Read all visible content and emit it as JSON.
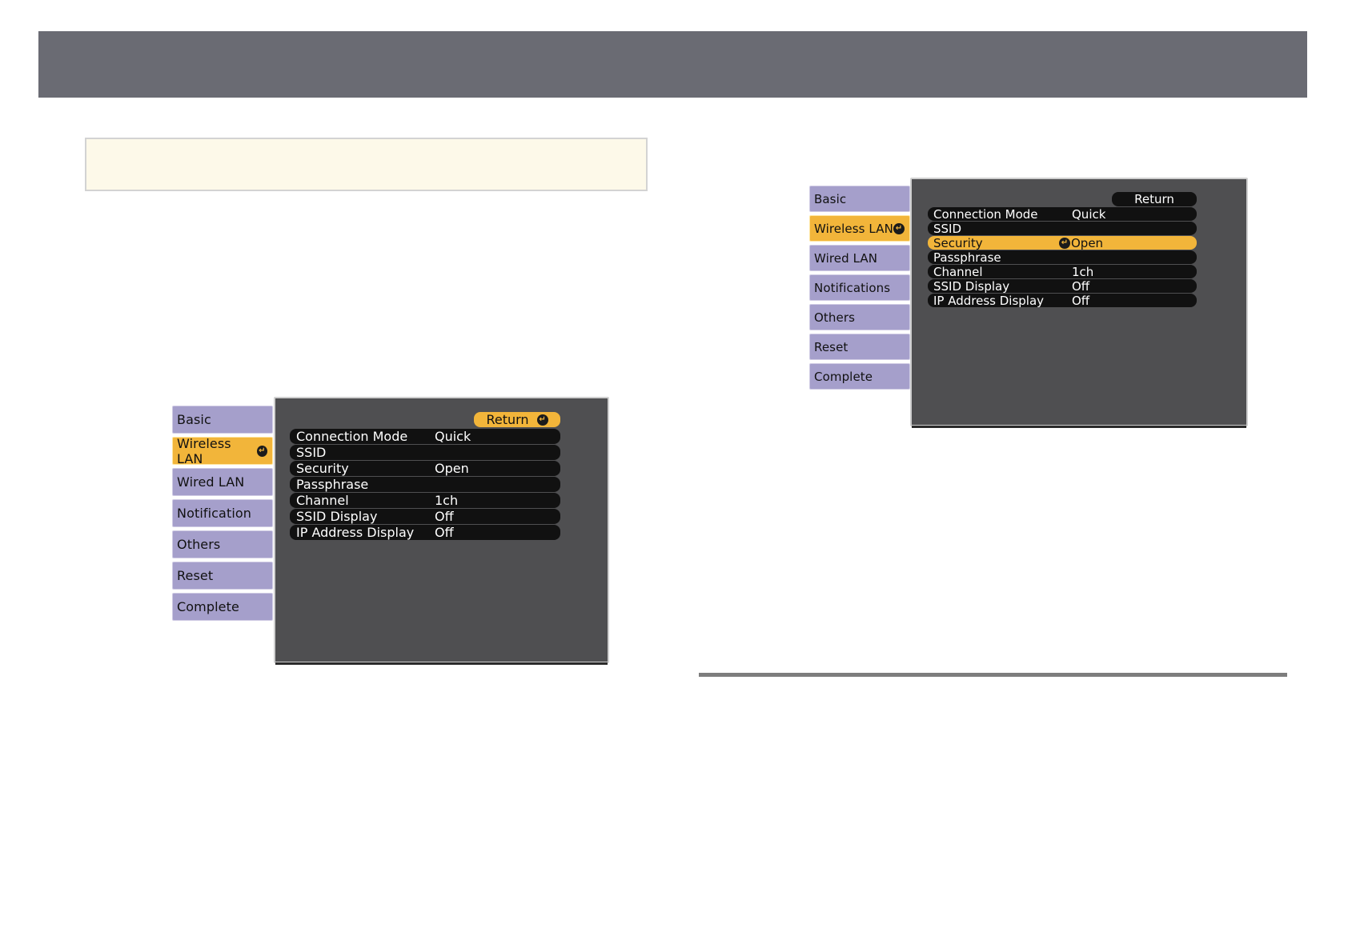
{
  "menu_left": {
    "tabs": [
      "Basic",
      "Wireless LAN",
      "Wired LAN",
      "Notification",
      "Others",
      "Reset",
      "Complete"
    ],
    "active_tab": "Wireless LAN",
    "return_label": "Return",
    "rows": [
      {
        "label": "Connection Mode",
        "value": "Quick"
      },
      {
        "label": "SSID",
        "value": ""
      },
      {
        "label": "Security",
        "value": "Open"
      },
      {
        "label": "Passphrase",
        "value": ""
      },
      {
        "label": "Channel",
        "value": "1ch"
      },
      {
        "label": "SSID Display",
        "value": "Off"
      },
      {
        "label": "IP Address Display",
        "value": "Off"
      }
    ]
  },
  "menu_right": {
    "tabs": [
      "Basic",
      "Wireless LAN",
      "Wired LAN",
      "Notifications",
      "Others",
      "Reset",
      "Complete"
    ],
    "active_tab": "Wireless LAN",
    "return_label": "Return",
    "highlighted_row": "Security",
    "rows": [
      {
        "label": "Connection Mode",
        "value": "Quick"
      },
      {
        "label": "SSID",
        "value": ""
      },
      {
        "label": "Security",
        "value": "Open"
      },
      {
        "label": "Passphrase",
        "value": ""
      },
      {
        "label": "Channel",
        "value": "1ch"
      },
      {
        "label": "SSID Display",
        "value": "Off"
      },
      {
        "label": "IP Address Display",
        "value": "Off"
      }
    ]
  },
  "colors": {
    "header_bar": "#6a6b73",
    "tab": "#a59fcb",
    "highlight": "#f2b53a",
    "panel": "#4f4f51",
    "note_box": "#fdf9e9"
  },
  "icons": {
    "enter": "enter-icon"
  }
}
